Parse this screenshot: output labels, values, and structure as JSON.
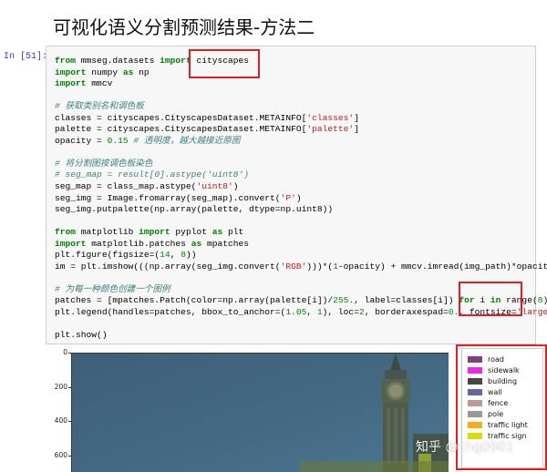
{
  "heading": "可视化语义分割预测结果-方法二",
  "prompt": "In [51]:",
  "code_lines": [
    [
      {
        "t": "from",
        "c": "kw"
      },
      {
        "t": " mmseg.datasets "
      },
      {
        "t": "import",
        "c": "kw"
      },
      {
        "t": " cityscapes"
      }
    ],
    [
      {
        "t": "import",
        "c": "kw"
      },
      {
        "t": " numpy "
      },
      {
        "t": "as",
        "c": "kw"
      },
      {
        "t": " np"
      }
    ],
    [
      {
        "t": "import",
        "c": "kw"
      },
      {
        "t": " mmcv"
      }
    ],
    [],
    [
      {
        "t": "# 获取类别名和调色板",
        "c": "cm"
      }
    ],
    [
      {
        "t": "classes = cityscapes.CityscapesDataset.METAINFO["
      },
      {
        "t": "'classes'",
        "c": "str"
      },
      {
        "t": "]"
      }
    ],
    [
      {
        "t": "palette = cityscapes.CityscapesDataset.METAINFO["
      },
      {
        "t": "'palette'",
        "c": "str"
      },
      {
        "t": "]"
      }
    ],
    [
      {
        "t": "opacity = "
      },
      {
        "t": "0.15",
        "c": "num"
      },
      {
        "t": " "
      },
      {
        "t": "# 透明度，越大越接近原图",
        "c": "cm"
      }
    ],
    [],
    [
      {
        "t": "# 将分割图按调色板染色",
        "c": "cm"
      }
    ],
    [
      {
        "t": "# seg_map = result[0].astype('uint8')",
        "c": "cm"
      }
    ],
    [
      {
        "t": "seg_map = class_map.astype("
      },
      {
        "t": "'uint8'",
        "c": "str"
      },
      {
        "t": ")"
      }
    ],
    [
      {
        "t": "seg_img = Image.fromarray(seg_map).convert("
      },
      {
        "t": "'P'",
        "c": "str"
      },
      {
        "t": ")"
      }
    ],
    [
      {
        "t": "seg_img.putpalette(np.array(palette, dtype=np.uint8))"
      }
    ],
    [],
    [
      {
        "t": "from",
        "c": "kw"
      },
      {
        "t": " matplotlib "
      },
      {
        "t": "import",
        "c": "kw"
      },
      {
        "t": " pyplot "
      },
      {
        "t": "as",
        "c": "kw"
      },
      {
        "t": " plt"
      }
    ],
    [
      {
        "t": "import",
        "c": "kw"
      },
      {
        "t": " matplotlib.patches "
      },
      {
        "t": "as",
        "c": "kw"
      },
      {
        "t": " mpatches"
      }
    ],
    [
      {
        "t": "plt.figure(figsize=("
      },
      {
        "t": "14",
        "c": "num"
      },
      {
        "t": ", "
      },
      {
        "t": "8",
        "c": "num"
      },
      {
        "t": "))"
      }
    ],
    [
      {
        "t": "im = plt.imshow(((np.array(seg_img.convert("
      },
      {
        "t": "'RGB'",
        "c": "str"
      },
      {
        "t": ")))*("
      },
      {
        "t": "1",
        "c": "num"
      },
      {
        "t": "-opacity) + mmcv.imread(img_path)*opacity) /"
      }
    ],
    [],
    [
      {
        "t": "# 为每一种颜色创建一个图例",
        "c": "cm"
      }
    ],
    [
      {
        "t": "patches = [mpatches.Patch(color=np.array(palette[i])/"
      },
      {
        "t": "255.",
        "c": "num"
      },
      {
        "t": ", label=classes[i]) "
      },
      {
        "t": "for",
        "c": "kw"
      },
      {
        "t": " i "
      },
      {
        "t": "in",
        "c": "kw"
      },
      {
        "t": " range("
      },
      {
        "t": "8",
        "c": "num"
      },
      {
        "t": ")]"
      }
    ],
    [
      {
        "t": "plt.legend(handles=patches, bbox_to_anchor=("
      },
      {
        "t": "1.05",
        "c": "num"
      },
      {
        "t": ", "
      },
      {
        "t": "1",
        "c": "num"
      },
      {
        "t": "), loc="
      },
      {
        "t": "2",
        "c": "num"
      },
      {
        "t": ", borderaxespad="
      },
      {
        "t": "0.",
        "c": "num"
      },
      {
        "t": ", fontsize="
      },
      {
        "t": "'large'",
        "c": "str"
      },
      {
        "t": ")"
      }
    ],
    [],
    [
      {
        "t": "plt.show()"
      }
    ]
  ],
  "yticks": [
    "0",
    "200",
    "400",
    "600"
  ],
  "legend": [
    {
      "label": "road",
      "color": "#804080"
    },
    {
      "label": "sidewalk",
      "color": "#f423e8"
    },
    {
      "label": "building",
      "color": "#464646"
    },
    {
      "label": "wall",
      "color": "#66669c"
    },
    {
      "label": "fence",
      "color": "#be9999"
    },
    {
      "label": "pole",
      "color": "#999999"
    },
    {
      "label": "traffic light",
      "color": "#faaa1e"
    },
    {
      "label": "traffic sign",
      "color": "#dcdc00"
    }
  ],
  "watermark": "知乎 @chg0901"
}
